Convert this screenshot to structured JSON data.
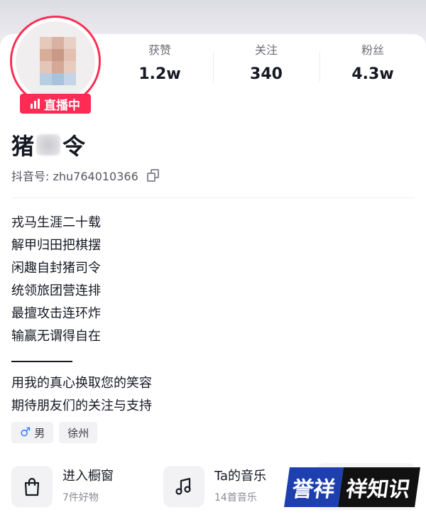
{
  "profile": {
    "live_badge": "直播中",
    "name_prefix": "猪",
    "name_suffix": "令",
    "douyin_id_label": "抖音号: zhu764010366"
  },
  "stats": [
    {
      "label": "获赞",
      "value": "1.2w"
    },
    {
      "label": "关注",
      "value": "340"
    },
    {
      "label": "粉丝",
      "value": "4.3w"
    }
  ],
  "bio": {
    "poem": [
      "戎马生涯二十载",
      "解甲归田把棋摆",
      "闲趣自封猪司令",
      "统领旅团营连排",
      "最擅攻击连环炸",
      "输赢无谓得自在"
    ],
    "closing": [
      "用我的真心换取您的笑容",
      "期待朋友们的关注与支持"
    ]
  },
  "tags": {
    "gender": "男",
    "location": "徐州"
  },
  "entries": {
    "shop": {
      "title": "进入橱窗",
      "sub": "7件好物"
    },
    "music": {
      "title": "Ta的音乐",
      "sub": "14首音乐"
    }
  },
  "watermark": {
    "part1": "誉祥",
    "part2": "祥知识"
  },
  "colors": {
    "live_red": "#fe2c55",
    "male_blue": "#2b7cff",
    "watermark_blue": "#1e3fae"
  },
  "icons": [
    "live-signal-icon",
    "copy-icon",
    "male-icon",
    "shopping-bag-icon",
    "music-note-icon"
  ]
}
